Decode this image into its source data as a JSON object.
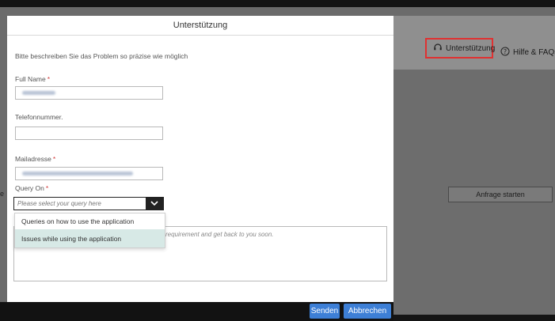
{
  "modal": {
    "title": "Unterstützung",
    "intro": "Bitte beschreiben Sie das Problem so präzise wie möglich",
    "full_name_label": "Full Name",
    "phone_label": "Telefonnummer.",
    "email_label": "Mailadresse",
    "query_label": "Query On",
    "required_mark": "*",
    "query_placeholder": "Please select your query here",
    "options": [
      "Queries on how to use the application",
      "Issues while using the application"
    ],
    "textarea_placeholder": "requirement and get back to you soon.",
    "send_label": "Senden",
    "cancel_label": "Abbrechen"
  },
  "header": {
    "support_label": "Unterstützung",
    "help_label": "Hilfe & FAQs"
  },
  "background": {
    "start_request_label": "Anfrage starten",
    "edge_letter": "e"
  },
  "colors": {
    "accent_button": "#3d7fd6",
    "highlight_border": "#e03131",
    "selected_option": "#d7e9e6"
  }
}
